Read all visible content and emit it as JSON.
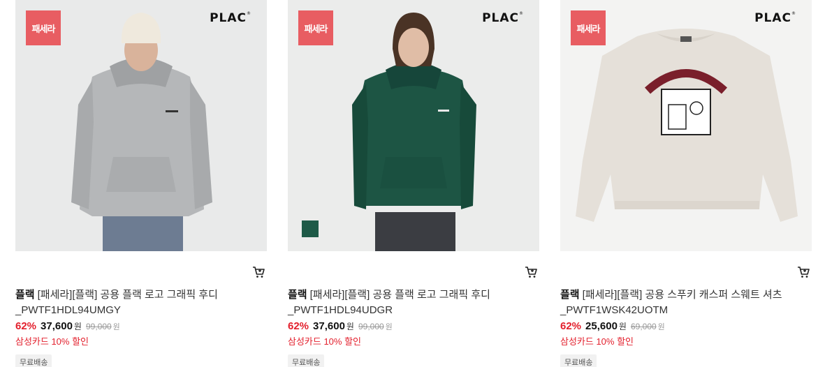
{
  "products": [
    {
      "badge": "패세라",
      "logo": "PLAC",
      "brand": "플랙",
      "name": "[패세라][플랙] 공용 플랙 로고 그래픽 후디 _PWTF1HDL94UMGY",
      "discount": "62%",
      "price": "37,600",
      "currency": "원",
      "original_price": "99,000",
      "original_currency": "원",
      "card_promo": "삼성카드 10% 할인",
      "shipping": "무료배송",
      "color_swatch": null
    },
    {
      "badge": "패세라",
      "logo": "PLAC",
      "brand": "플랙",
      "name": "[패세라][플랙] 공용 플랙 로고 그래픽 후디 _PWTF1HDL94UDGR",
      "discount": "62%",
      "price": "37,600",
      "currency": "원",
      "original_price": "99,000",
      "original_currency": "원",
      "card_promo": "삼성카드 10% 할인",
      "shipping": "무료배송",
      "color_swatch": "#1e5a47"
    },
    {
      "badge": "패세라",
      "logo": "PLAC",
      "brand": "플랙",
      "name": "[패세라][플랙] 공용 스푸키 캐스퍼 스웨트 셔츠 _PWTF1WSK42UOTM",
      "discount": "62%",
      "price": "25,600",
      "currency": "원",
      "original_price": "69,000",
      "original_currency": "원",
      "card_promo": "삼성카드 10% 할인",
      "shipping": "무료배송",
      "color_swatch": null
    }
  ],
  "icons": {
    "cart": "cart-icon"
  }
}
